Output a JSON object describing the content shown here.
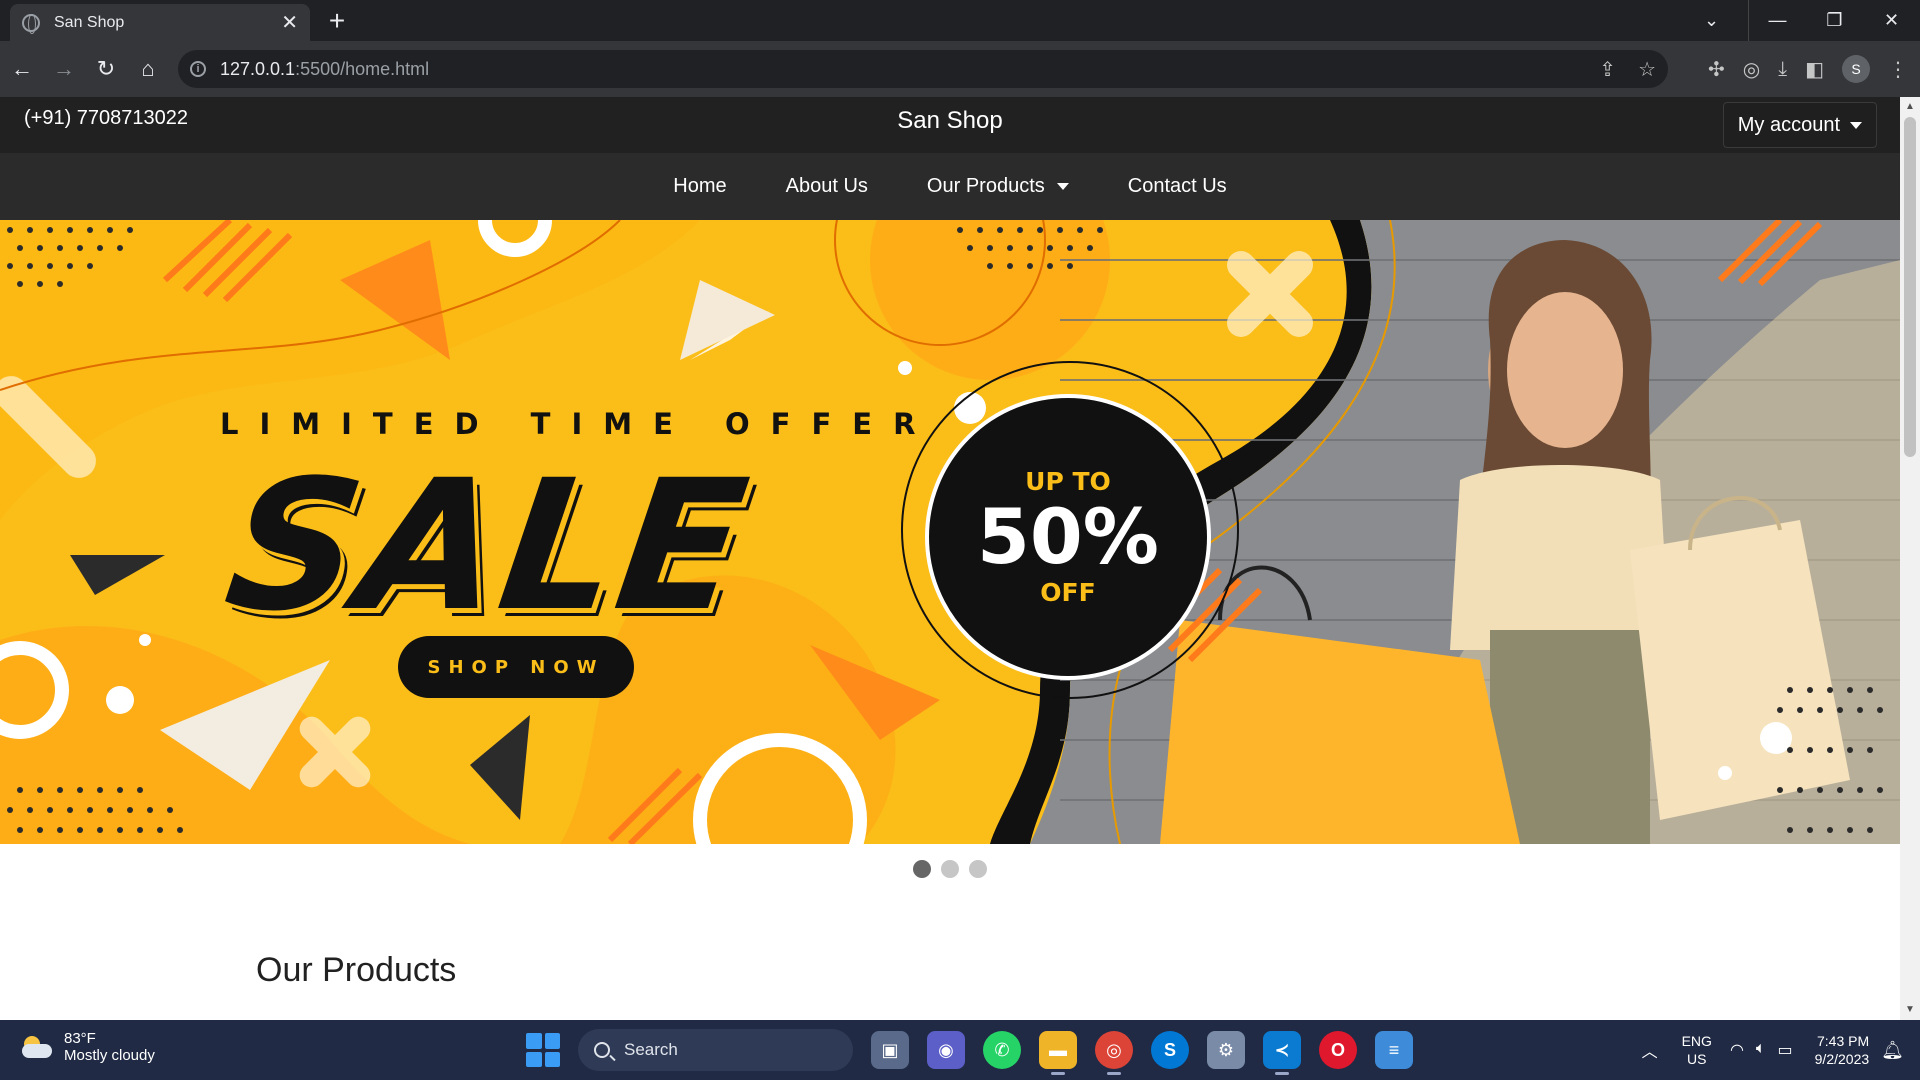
{
  "browser": {
    "tab_title": "San Shop",
    "tab_close": "✕",
    "new_tab": "+",
    "url_host": "127.0.0.1",
    "url_rest": ":5500/home.html",
    "profile_initial": "S",
    "window_controls": [
      "⌄",
      "—",
      "❐",
      "✕"
    ]
  },
  "site": {
    "phone": "(+91) 7708713022",
    "brand": "San Shop",
    "account_label": "My account",
    "nav": [
      "Home",
      "About Us",
      "Our Products",
      "Contact Us"
    ]
  },
  "hero": {
    "tagline": "LIMITED TIME OFFER",
    "headline": "SALE",
    "cta": "SHOP NOW",
    "badge_top": "UP TO",
    "badge_value": "50%",
    "badge_bottom": "OFF",
    "slide_count": 3,
    "active_slide": 1,
    "colors": {
      "background": "#fbbd18",
      "accent": "#f57c00",
      "dark": "#111111"
    }
  },
  "section": {
    "title": "Our Products"
  },
  "taskbar": {
    "weather_temp": "83°F",
    "weather_cond": "Mostly cloudy",
    "search_label": "Search",
    "lang_line1": "ENG",
    "lang_line2": "US",
    "time": "7:43 PM",
    "date": "9/2/2023",
    "apps": [
      {
        "name": "task-view",
        "color": "#596a8a"
      },
      {
        "name": "teams",
        "color": "#5b5fc7"
      },
      {
        "name": "whatsapp",
        "color": "#25d366"
      },
      {
        "name": "file-explorer",
        "color": "#f0b429"
      },
      {
        "name": "chrome",
        "color": "#db4437"
      },
      {
        "name": "skype",
        "color": "#0078d4"
      },
      {
        "name": "settings",
        "color": "#7a8ba8"
      },
      {
        "name": "vscode",
        "color": "#0a7bd0"
      },
      {
        "name": "opera",
        "color": "#e0182d"
      },
      {
        "name": "notepad",
        "color": "#3d8bd9"
      }
    ]
  }
}
